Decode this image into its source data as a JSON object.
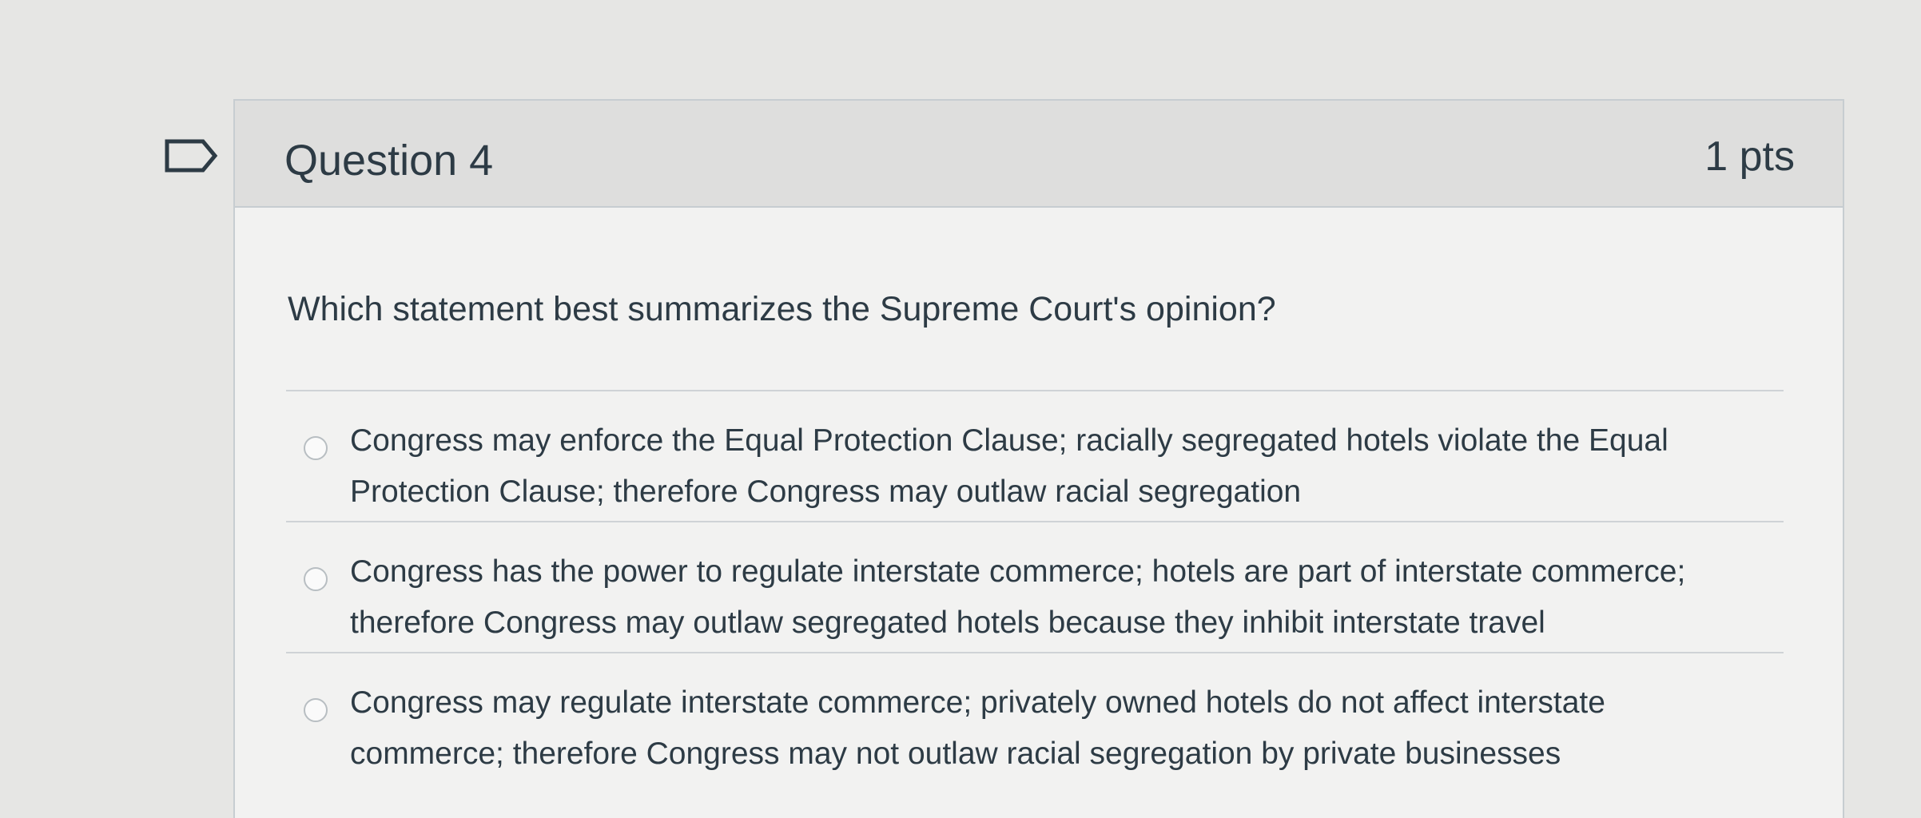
{
  "question": {
    "title": "Question 4",
    "points": "1 pts",
    "text": "Which statement best summarizes the Supreme Court's opinion?",
    "answers": [
      {
        "text": "Congress may enforce the Equal Protection Clause; racially segregated hotels violate the Equal Protection Clause; therefore Congress may outlaw racial segregation"
      },
      {
        "text": "Congress has the power to regulate interstate commerce; hotels are part of interstate commerce; therefore Congress may outlaw segregated hotels because they inhibit interstate travel"
      },
      {
        "text": "Congress may regulate interstate commerce; privately owned hotels do not affect interstate commerce; therefore Congress may not outlaw racial segregation by private businesses"
      }
    ]
  },
  "icons": {
    "flag": "flag-question-icon"
  },
  "colors": {
    "text": "#2d3b45",
    "header_background": "#dededd",
    "border": "#c7cdd1"
  }
}
